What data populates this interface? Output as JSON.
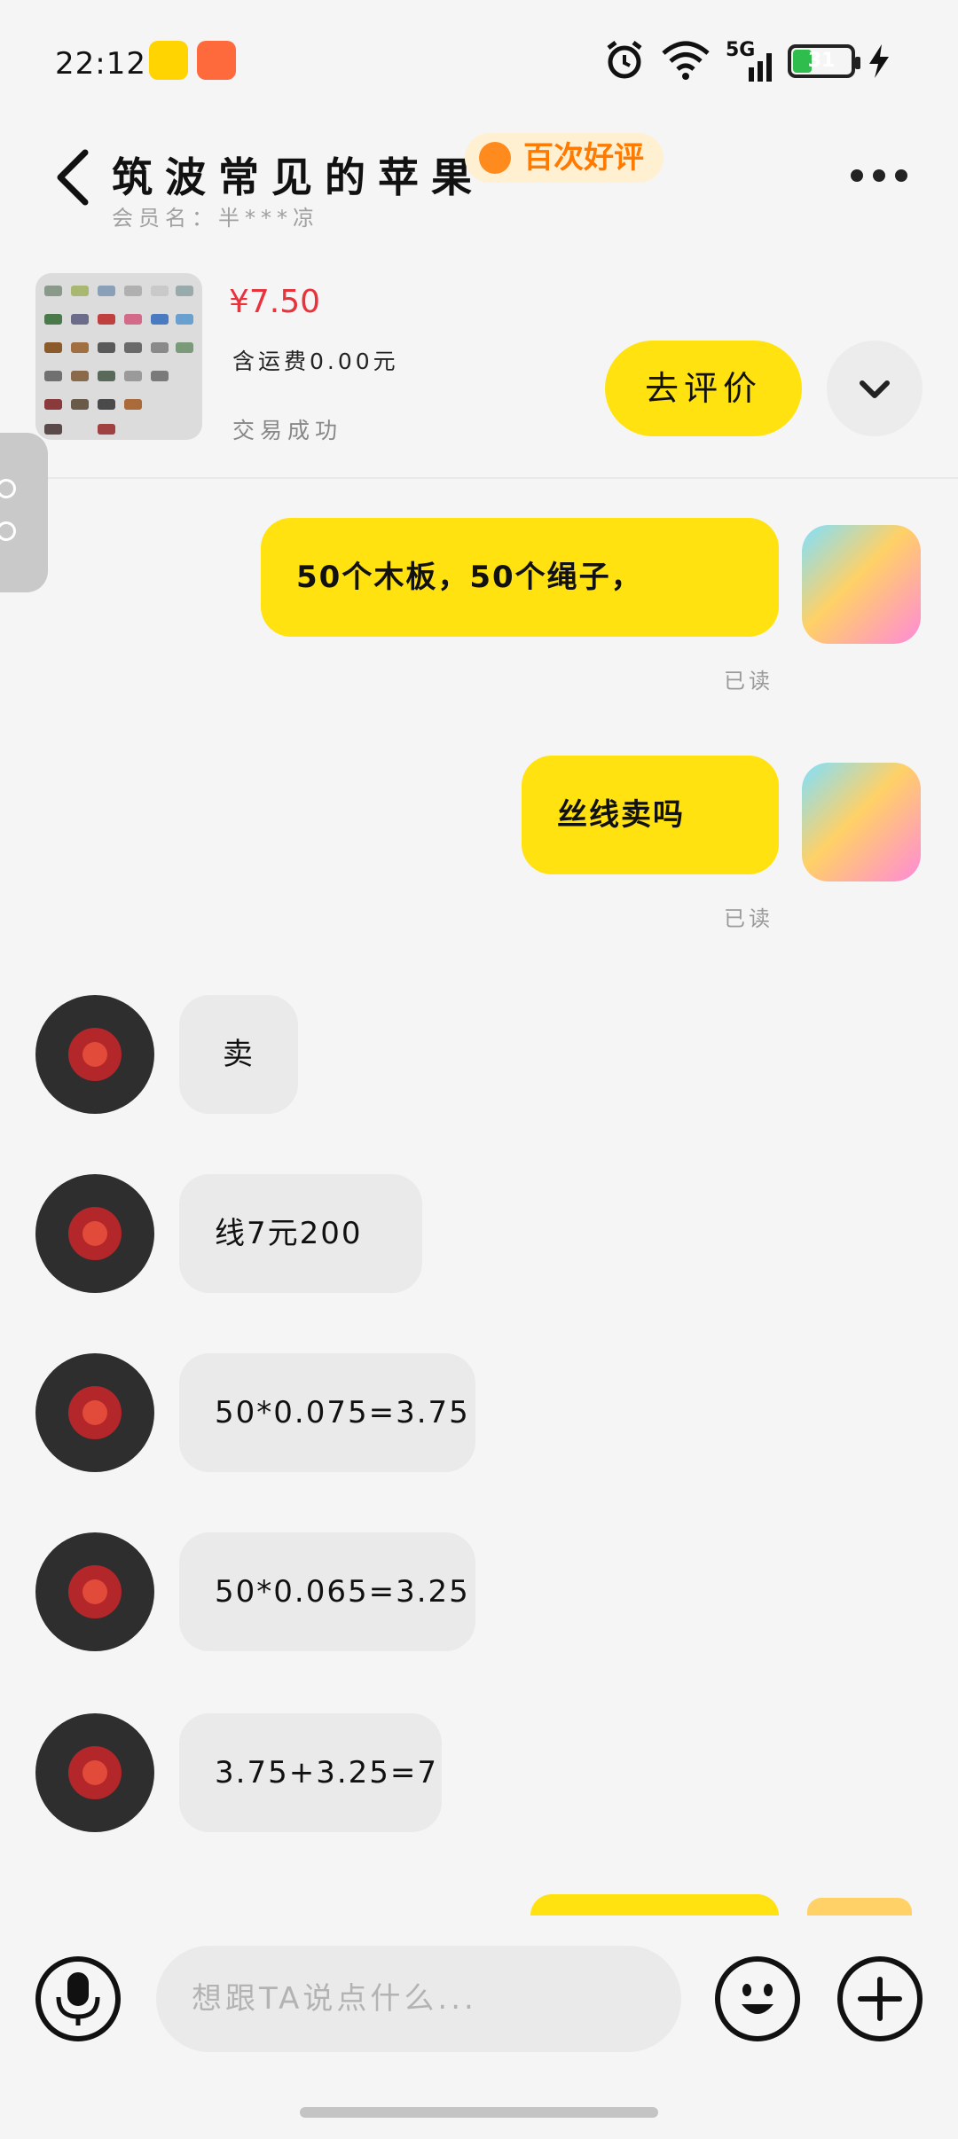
{
  "status": {
    "time": "22:12",
    "network": "5G",
    "battery": "31"
  },
  "header": {
    "title": "筑波常见的苹果",
    "badge": "百次好评",
    "member_name": "会员名：半***凉"
  },
  "product": {
    "price": "¥7.50",
    "shipping": "含运费0.00元",
    "deal_status": "交易成功",
    "review_button": "去评价"
  },
  "messages": [
    {
      "from": "me",
      "text": "50个木板，50个绳子，",
      "read": "已读"
    },
    {
      "from": "me",
      "text": "丝线卖吗",
      "read": "已读"
    },
    {
      "from": "other",
      "text": "卖"
    },
    {
      "from": "other",
      "text": "线7元200"
    },
    {
      "from": "other",
      "text": "50*0.075=3.75"
    },
    {
      "from": "other",
      "text": "50*0.065=3.25"
    },
    {
      "from": "other",
      "text": "3.75+3.25=7"
    }
  ],
  "input": {
    "placeholder": "想跟TA说点什么..."
  },
  "icons": {
    "back": "back-arrow-icon",
    "more": "more-dots-icon",
    "collapse": "chevron-down-icon",
    "voice": "microphone-icon",
    "emoji": "emoji-icon",
    "add": "plus-icon"
  },
  "colors": {
    "accent": "#ffe20f",
    "price": "#e8323c",
    "badge_text": "#ff7a00",
    "background": "#f5f5f5"
  }
}
